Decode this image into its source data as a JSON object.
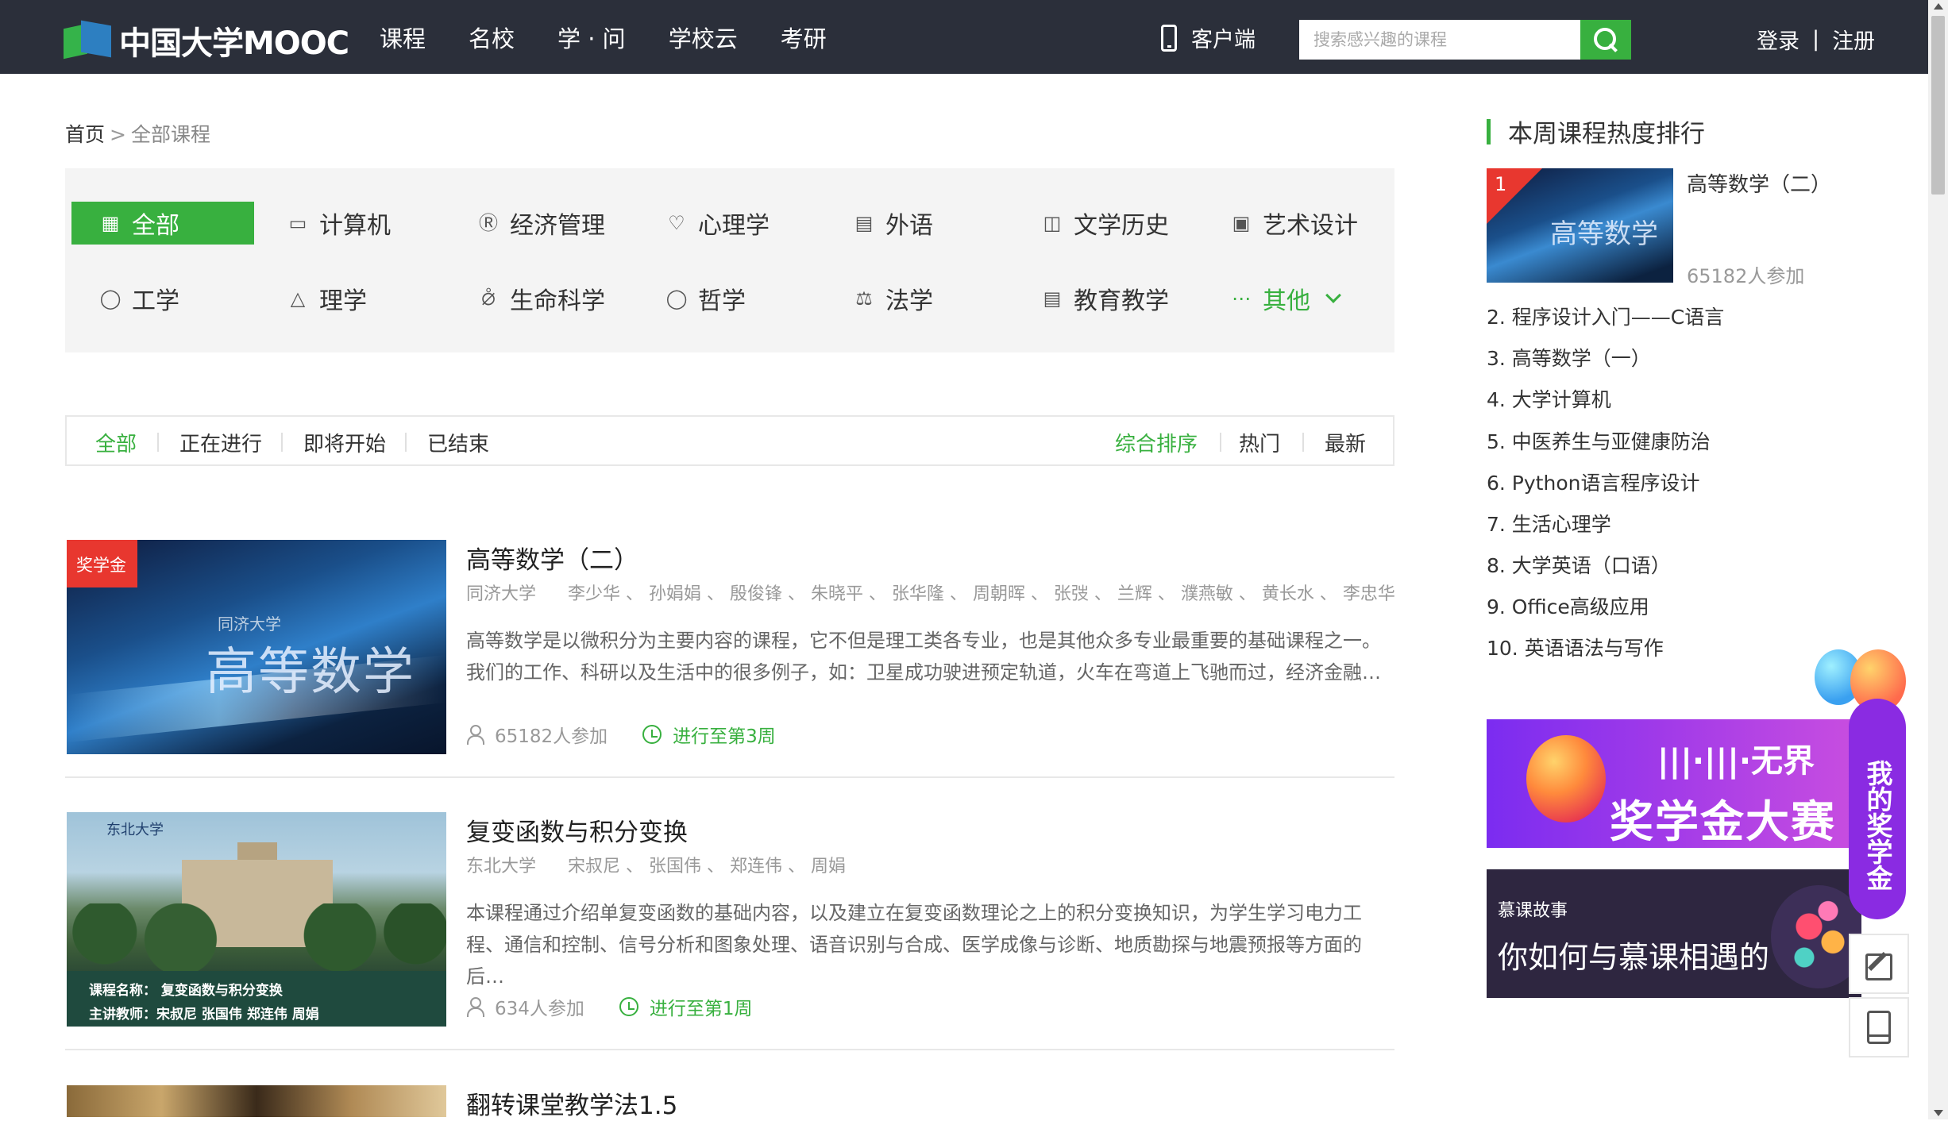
{
  "nav": {
    "logo_text": "中国大学MOOC",
    "links": [
      "课程",
      "名校",
      "学 · 问",
      "学校云",
      "考研"
    ],
    "client_label": "客户端",
    "search_placeholder": "搜索感兴趣的课程",
    "login": "登录",
    "separator": "|",
    "register": "注册"
  },
  "breadcrumb": {
    "home": "首页",
    "sep": ">",
    "current": "全部课程"
  },
  "categories": [
    {
      "label": "全部",
      "icon": "grid-icon"
    },
    {
      "label": "计算机",
      "icon": "monitor-icon"
    },
    {
      "label": "经济管理",
      "icon": "dollar-icon"
    },
    {
      "label": "心理学",
      "icon": "heart-icon"
    },
    {
      "label": "外语",
      "icon": "chat-icon"
    },
    {
      "label": "文学历史",
      "icon": "book-icon"
    },
    {
      "label": "艺术设计",
      "icon": "image-icon"
    },
    {
      "label": "工学",
      "icon": "bulb-icon"
    },
    {
      "label": "理学",
      "icon": "flask-icon"
    },
    {
      "label": "生命科学",
      "icon": "pill-icon"
    },
    {
      "label": "哲学",
      "icon": "idea-icon"
    },
    {
      "label": "法学",
      "icon": "scale-icon"
    },
    {
      "label": "教育教学",
      "icon": "document-icon"
    },
    {
      "label": "其他",
      "icon": "more-icon"
    }
  ],
  "filters": {
    "status": [
      "全部",
      "正在进行",
      "即将开始",
      "已结束"
    ],
    "sort": [
      "综合排序",
      "热门",
      "最新"
    ]
  },
  "courses": [
    {
      "title": "高等数学（二）",
      "badge": "奖学金",
      "thumb_small": "同济大学",
      "thumb_big": "高等数学",
      "school": "同济大学",
      "teachers": "李少华 、 孙娟娟 、 殷俊锋 、 朱晓平 、 张华隆 、 周朝晖 、 张弢 、 兰辉 、 濮燕敏 、 黄长水 、 李忠华",
      "desc": "高等数学是以微积分为主要内容的课程，它不但是理工类各专业，也是其他众多专业最重要的基础课程之一。我们的工作、科研以及生活中的很多例子，如：卫星成功驶进预定轨道，火车在弯道上飞驰而过，经济金融…",
      "enrolled": "65182人参加",
      "progress": "进行至第3周"
    },
    {
      "title": "复变函数与积分变换",
      "thumb_school": "东北大学",
      "thumb_line1": "课程名称： 复变函数与积分变换",
      "thumb_line2": "主讲教师：宋叔尼  张国伟  郑连伟  周娟",
      "school": "东北大学",
      "teachers": "宋叔尼 、 张国伟 、 郑连伟 、 周娟",
      "desc": "本课程通过介绍单复变函数的基础内容，以及建立在复变函数理论之上的积分变换知识，为学生学习电力工程、通信和控制、信号分析和图象处理、语音识别与合成、医学成像与诊断、地质勘探与地震预报等方面的后…",
      "enrolled": "634人参加",
      "progress": "进行至第1周"
    },
    {
      "title": "翻转课堂教学法1.5"
    }
  ],
  "sidebar": {
    "heading": "本周课程热度排行",
    "top": {
      "rank": "1",
      "thumb_text": "高等数学",
      "title": "高等数学（二）",
      "count": "65182人参加"
    },
    "ranks": [
      "2. 程序设计入门——C语言",
      "3. 高等数学（一）",
      "4. 大学计算机",
      "5. 中医养生与亚健康防治",
      "6. Python语言程序设计",
      "7. 生活心理学",
      "8. 大学英语（口语）",
      "9. Office高级应用",
      "10. 英语语法与写作"
    ],
    "ad1": {
      "line1": "|||·|||·无界",
      "line2": "奖学金大赛"
    },
    "ad2": {
      "small": "慕课故事",
      "main": "你如何与慕课相遇的"
    }
  },
  "floating": {
    "scholarship": "我的奖学金"
  },
  "colors": {
    "accent": "#38b03f",
    "nav_bg": "#2b2f3a",
    "badge_red": "#e8372f",
    "ad_purple": "#8a2be2"
  }
}
